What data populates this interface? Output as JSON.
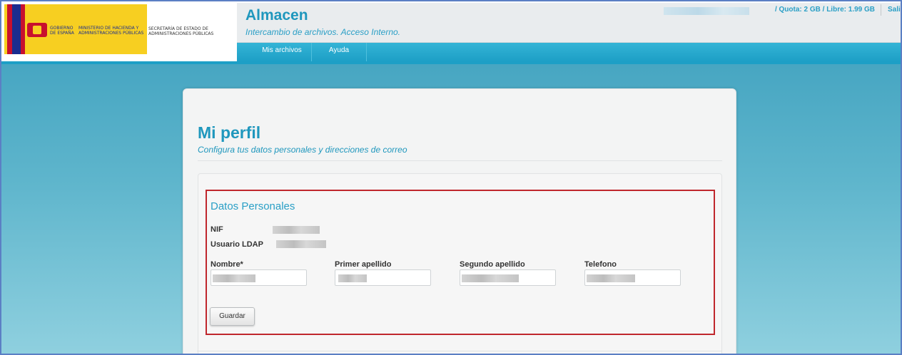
{
  "header": {
    "logo": {
      "gobierno": "GOBIERNO DE ESPAÑA",
      "ministerio": "MINISTERIO DE HACIENDA Y ADMINISTRACIONES PÚBLICAS",
      "secretaria": "SECRETARÍA DE ESTADO DE ADMINISTRACIONES PÚBLICAS"
    },
    "app_title": "Almacen",
    "app_subtitle": "Intercambio de archivos. Acceso Interno.",
    "quota_text": "/ Quota: 2 GB / Libre: 1.99 GB",
    "logout_label": "Salir",
    "nav": [
      {
        "label": "Mis archivos"
      },
      {
        "label": "Ayuda"
      }
    ]
  },
  "page": {
    "title": "Mi perfil",
    "subtitle": "Configura tus datos personales y direcciones de correo"
  },
  "personal": {
    "section_title": "Datos Personales",
    "nif_label": "NIF",
    "ldap_label": "Usuario LDAP",
    "fields": [
      {
        "label": "Nombre*"
      },
      {
        "label": "Primer apellido"
      },
      {
        "label": "Segundo apellido"
      },
      {
        "label": "Telefono"
      }
    ],
    "save_label": "Guardar"
  },
  "colors": {
    "accent": "#1f97bd",
    "highlight_border": "#c0272d"
  }
}
